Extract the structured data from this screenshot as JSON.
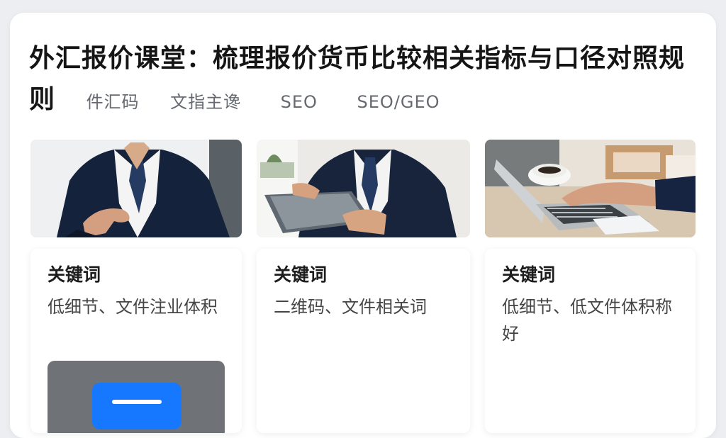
{
  "header": {
    "title": "外汇报价课堂：梳理报价货币比较相关指标与口径对照规则",
    "tags": [
      "件汇码",
      "文指主谗",
      "SEO",
      "SEO/GEO"
    ]
  },
  "cards": [
    {
      "title": "关键词",
      "text": "低细节、文件注业体积",
      "photo": "businessman-suit-hand-gesture"
    },
    {
      "title": "关键词",
      "text": "二维码、文件相关词",
      "photo": "businessman-holding-tablet"
    },
    {
      "title": "关键词",
      "text": "低细节、低文件体积称好",
      "photo": "hand-typing-on-laptop"
    }
  ],
  "colors": {
    "accent": "#1677ff",
    "preview_gray": "#6f7378"
  },
  "icons": {
    "preview_icon": "document-lines-icon"
  }
}
